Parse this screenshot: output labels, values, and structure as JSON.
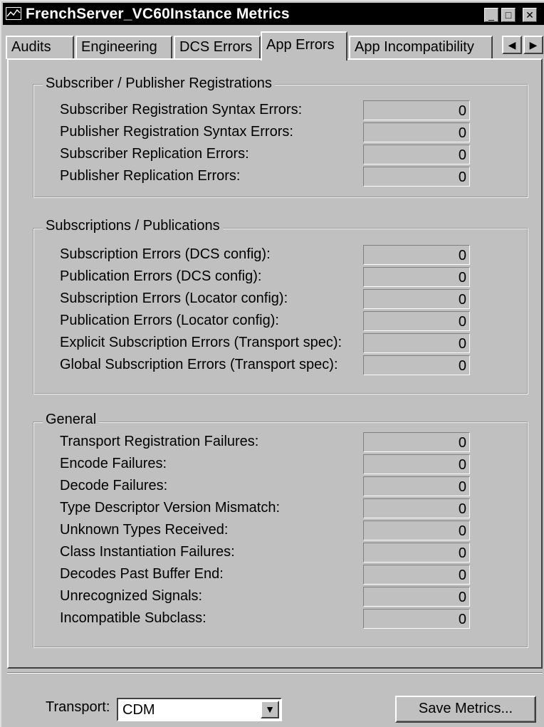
{
  "window": {
    "title": "FrenchServer_VC60Instance Metrics"
  },
  "tabs": [
    "Audits",
    "Engineering",
    "DCS Errors",
    "App Errors",
    "App Incompatibility"
  ],
  "active_tab": "App Errors",
  "groups": {
    "registrations": {
      "title": "Subscriber / Publisher Registrations",
      "rows": [
        {
          "label": "Subscriber Registration Syntax Errors:",
          "value": "0"
        },
        {
          "label": "Publisher Registration Syntax Errors:",
          "value": "0"
        },
        {
          "label": "Subscriber Replication Errors:",
          "value": "0"
        },
        {
          "label": "Publisher Replication Errors:",
          "value": "0"
        }
      ]
    },
    "subscriptions": {
      "title": "Subscriptions / Publications",
      "rows": [
        {
          "label": "Subscription Errors (DCS config):",
          "value": "0"
        },
        {
          "label": "Publication Errors (DCS config):",
          "value": "0"
        },
        {
          "label": "Subscription Errors (Locator config):",
          "value": "0"
        },
        {
          "label": "Publication Errors (Locator config):",
          "value": "0"
        },
        {
          "label": "Explicit Subscription Errors (Transport spec):",
          "value": "0"
        },
        {
          "label": "Global Subscription Errors (Transport spec):",
          "value": "0"
        }
      ]
    },
    "general": {
      "title": "General",
      "rows": [
        {
          "label": "Transport Registration Failures:",
          "value": "0"
        },
        {
          "label": "Encode Failures:",
          "value": "0"
        },
        {
          "label": "Decode Failures:",
          "value": "0"
        },
        {
          "label": "Type Descriptor Version Mismatch:",
          "value": "0"
        },
        {
          "label": "Unknown Types Received:",
          "value": "0"
        },
        {
          "label": "Class Instantiation Failures:",
          "value": "0"
        },
        {
          "label": "Decodes Past Buffer End:",
          "value": "0"
        },
        {
          "label": "Unrecognized Signals:",
          "value": "0"
        },
        {
          "label": "Incompatible Subclass:",
          "value": "0"
        }
      ]
    }
  },
  "footer": {
    "transport_label": "Transport:",
    "transport_value": "CDM",
    "save_button": "Save Metrics..."
  }
}
